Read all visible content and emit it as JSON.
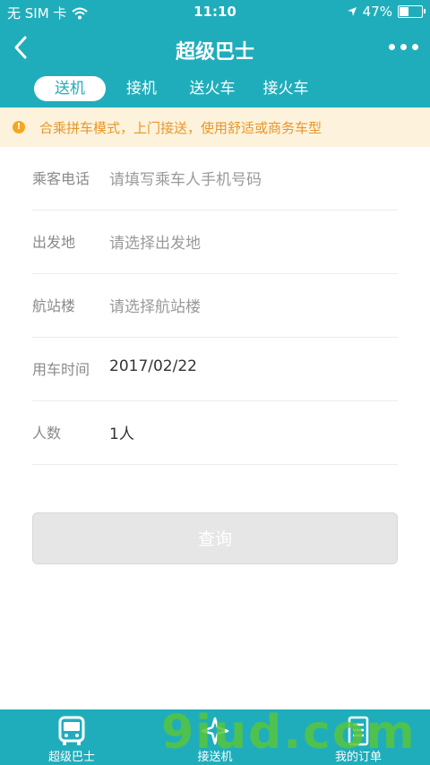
{
  "status_bar": {
    "carrier": "无 SIM 卡",
    "time": "11:10",
    "battery_percent": "47%",
    "battery_level": 0.47
  },
  "nav": {
    "title": "超级巴士"
  },
  "tabs": [
    {
      "label": "送机",
      "active": true
    },
    {
      "label": "接机",
      "active": false
    },
    {
      "label": "送火车",
      "active": false
    },
    {
      "label": "接火车",
      "active": false
    }
  ],
  "notice": {
    "text": "合乘拼车模式，上门接送，使用舒适或商务车型"
  },
  "form": {
    "rows": [
      {
        "label": "乘客电话",
        "value": "请填写乘车人手机号码",
        "placeholder": true
      },
      {
        "label": "出发地",
        "value": "请选择出发地",
        "placeholder": true
      },
      {
        "label": "航站楼",
        "value": "请选择航站楼",
        "placeholder": true
      },
      {
        "label": "用车时间",
        "value": "2017/02/22",
        "placeholder": false
      },
      {
        "label": "人数",
        "value": "1人",
        "placeholder": false
      }
    ]
  },
  "query_button": {
    "label": "查询"
  },
  "tabbar": [
    {
      "label": "超级巴士",
      "icon": "bus-icon"
    },
    {
      "label": "接送机",
      "icon": "plane-icon"
    },
    {
      "label": "我的订单",
      "icon": "order-icon"
    }
  ],
  "watermark": {
    "text": "9iud.com"
  },
  "colors": {
    "primary": "#20adbb",
    "notice_bg": "#fdf3dc",
    "notice_text": "#e8962b"
  }
}
